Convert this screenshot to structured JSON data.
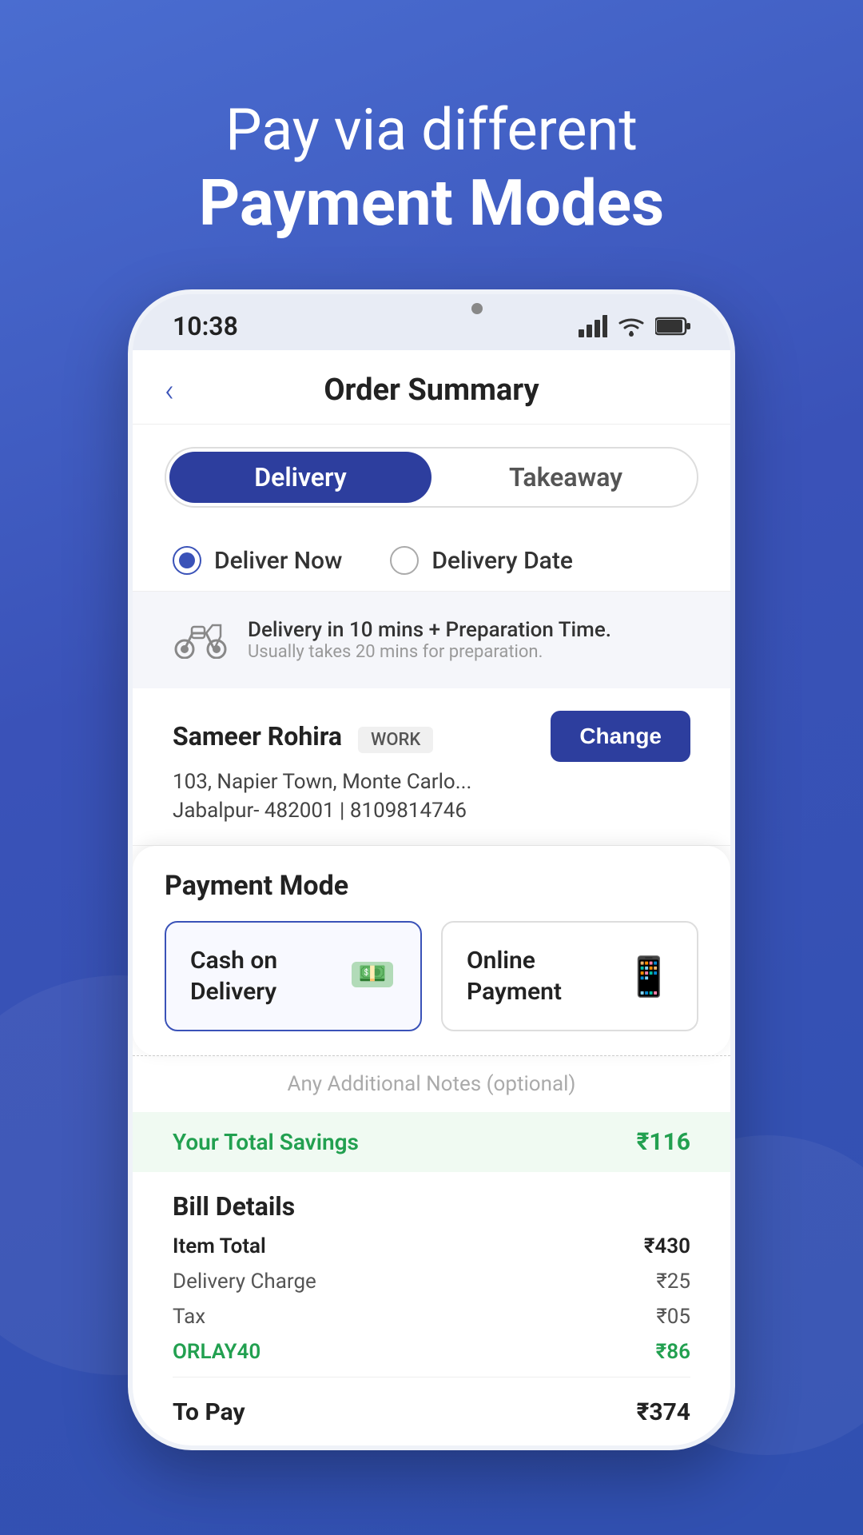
{
  "header": {
    "line1": "Pay via different",
    "line2": "Payment Modes"
  },
  "statusBar": {
    "time": "10:38",
    "signalIcon": "signal-bars-icon",
    "wifiIcon": "wifi-icon",
    "batteryIcon": "battery-icon"
  },
  "navBar": {
    "backIcon": "back-arrow-icon",
    "title": "Order Summary"
  },
  "orderType": {
    "deliveryLabel": "Delivery",
    "takeawayLabel": "Takeaway",
    "activeOption": "Delivery"
  },
  "deliveryTime": {
    "radioOption1": "Deliver Now",
    "radioOption2": "Delivery Date",
    "selectedOption": "Deliver Now"
  },
  "deliveryInfo": {
    "icon": "scooter-icon",
    "mainText": "Delivery in 10 mins + Preparation Time.",
    "subText": "Usually takes 20 mins for preparation."
  },
  "address": {
    "name": "Sameer Rohira",
    "tag": "WORK",
    "line1": "103, Napier Town, Monte Carlo...",
    "line2": "Jabalpur- 482001 | 8109814746",
    "changeLabel": "Change"
  },
  "paymentMode": {
    "title": "Payment Mode",
    "options": [
      {
        "id": "cod",
        "label": "Cash on\nDelivery",
        "icon": "💵",
        "selected": true
      },
      {
        "id": "online",
        "label": "Online\nPayment",
        "icon": "📱",
        "selected": false
      }
    ]
  },
  "notes": {
    "placeholder": "Any Additional Notes (optional)"
  },
  "savings": {
    "label": "Your Total Savings",
    "amount": "₹116"
  },
  "bill": {
    "title": "Bill Details",
    "rows": [
      {
        "label": "Item Total",
        "amount": "₹430",
        "style": "normal"
      },
      {
        "label": "Delivery Charge",
        "amount": "₹25",
        "style": "light"
      },
      {
        "label": "Tax",
        "amount": "₹05",
        "style": "light"
      },
      {
        "label": "ORLAY40",
        "amount": "₹86",
        "style": "promo"
      }
    ],
    "toPayLabel": "To Pay",
    "toPayAmount": "₹374"
  }
}
